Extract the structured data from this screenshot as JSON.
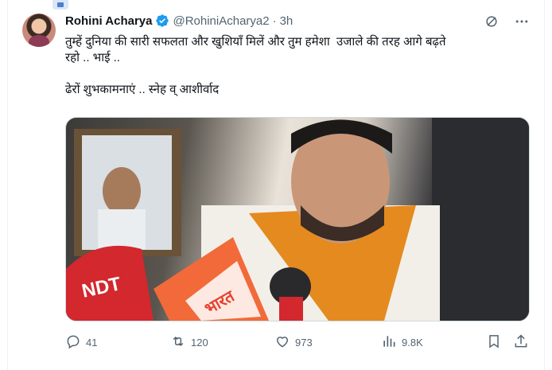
{
  "tweet": {
    "author_name": "Rohini Acharya",
    "handle": "@RohiniAcharya2",
    "separator": "·",
    "time": "3h",
    "text_line1": "तुम्हें दुनिया की सारी सफलता और खुशियाँ मिलें और तुम हमेशा  उजाले की तरह आगे बढ़ते",
    "text_line2": "रहो .. भाई ..",
    "text_line3": "ढेरों शुभकामनाएं .. स्नेह व् आशीर्वाद",
    "media_texts": {
      "mic_red": "NDT",
      "mic_right": "भारत"
    }
  },
  "actions": {
    "reply_count": "41",
    "retweet_count": "120",
    "like_count": "973",
    "views_count": "9.8K"
  },
  "icons": {
    "verified": "verified-badge-icon",
    "grok": "grok-icon",
    "more": "more-icon",
    "reply": "reply-icon",
    "retweet": "retweet-icon",
    "like": "heart-icon",
    "views": "views-icon",
    "bookmark": "bookmark-icon",
    "share": "share-icon"
  },
  "colors": {
    "accent": "#1d9bf0",
    "muted": "#536471",
    "text": "#0f1419"
  }
}
